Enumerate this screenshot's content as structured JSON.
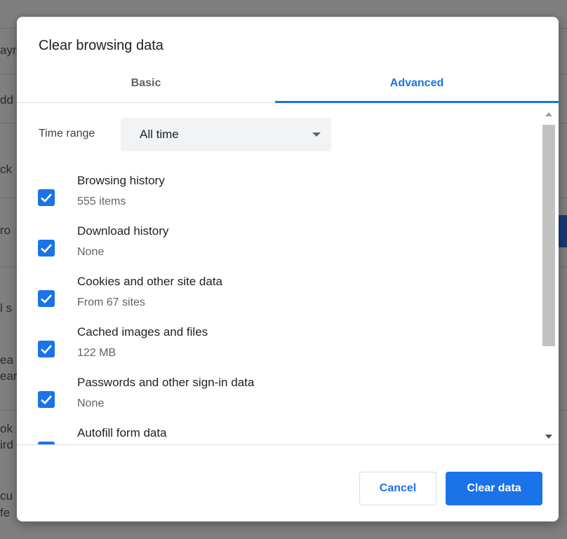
{
  "background": {
    "fragments": [
      "ayn",
      "dd",
      "ck",
      "ro",
      "l s",
      "ea",
      "ear",
      "ok",
      "ird",
      "cu",
      "fe"
    ]
  },
  "dialog": {
    "title": "Clear browsing data",
    "tabs": [
      {
        "label": "Basic",
        "active": false
      },
      {
        "label": "Advanced",
        "active": true
      }
    ],
    "time_range": {
      "label": "Time range",
      "value": "All time"
    },
    "options": [
      {
        "title": "Browsing history",
        "subtitle": "555 items",
        "checked": true
      },
      {
        "title": "Download history",
        "subtitle": "None",
        "checked": true
      },
      {
        "title": "Cookies and other site data",
        "subtitle": "From 67 sites",
        "checked": true
      },
      {
        "title": "Cached images and files",
        "subtitle": "122 MB",
        "checked": true
      },
      {
        "title": "Passwords and other sign-in data",
        "subtitle": "None",
        "checked": true
      },
      {
        "title": "Autofill form data",
        "subtitle": "",
        "checked": true
      }
    ],
    "buttons": {
      "cancel": "Cancel",
      "confirm": "Clear data"
    }
  },
  "colors": {
    "accent": "#1a73e8",
    "overlay": "#7f7f7f"
  }
}
